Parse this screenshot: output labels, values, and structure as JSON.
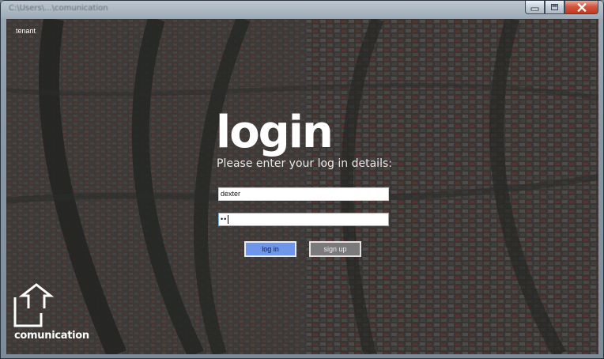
{
  "window": {
    "title": "C:\\Users\\...\\comunication",
    "controls": [
      "minimize",
      "maximize",
      "close"
    ]
  },
  "app": {
    "tenant_label": "tenant",
    "login_title": "login",
    "login_subtitle": "Please enter your log in details:",
    "username_value": "dexter",
    "password_masked": "••",
    "login_button": "log in",
    "signup_button": "sign up",
    "brand_name": "comunication",
    "brand_icon": "box-arrow-up-icon"
  },
  "colors": {
    "login_button_bg": "#6f96ea",
    "signup_button_bg": "#7a7a7a",
    "close_button": "#c0391f",
    "text_primary": "#ffffff"
  }
}
